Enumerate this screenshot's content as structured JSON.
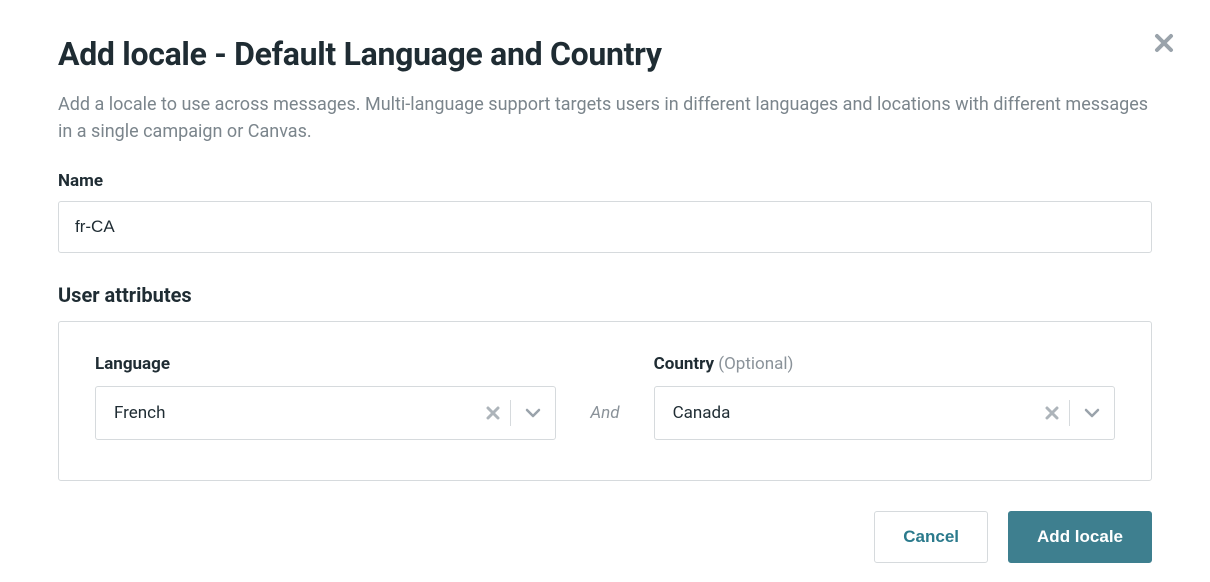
{
  "modal": {
    "title": "Add locale - Default Language and Country",
    "description": "Add a locale to use across messages. Multi-language support targets users in different languages and locations with different messages in a single campaign or Canvas."
  },
  "fields": {
    "name": {
      "label": "Name",
      "value": "fr-CA"
    }
  },
  "user_attributes": {
    "section_label": "User attributes",
    "language": {
      "label": "Language",
      "value": "French"
    },
    "separator": "And",
    "country": {
      "label": "Country",
      "optional_text": " (Optional)",
      "value": "Canada"
    }
  },
  "footer": {
    "cancel": "Cancel",
    "confirm": "Add locale"
  }
}
